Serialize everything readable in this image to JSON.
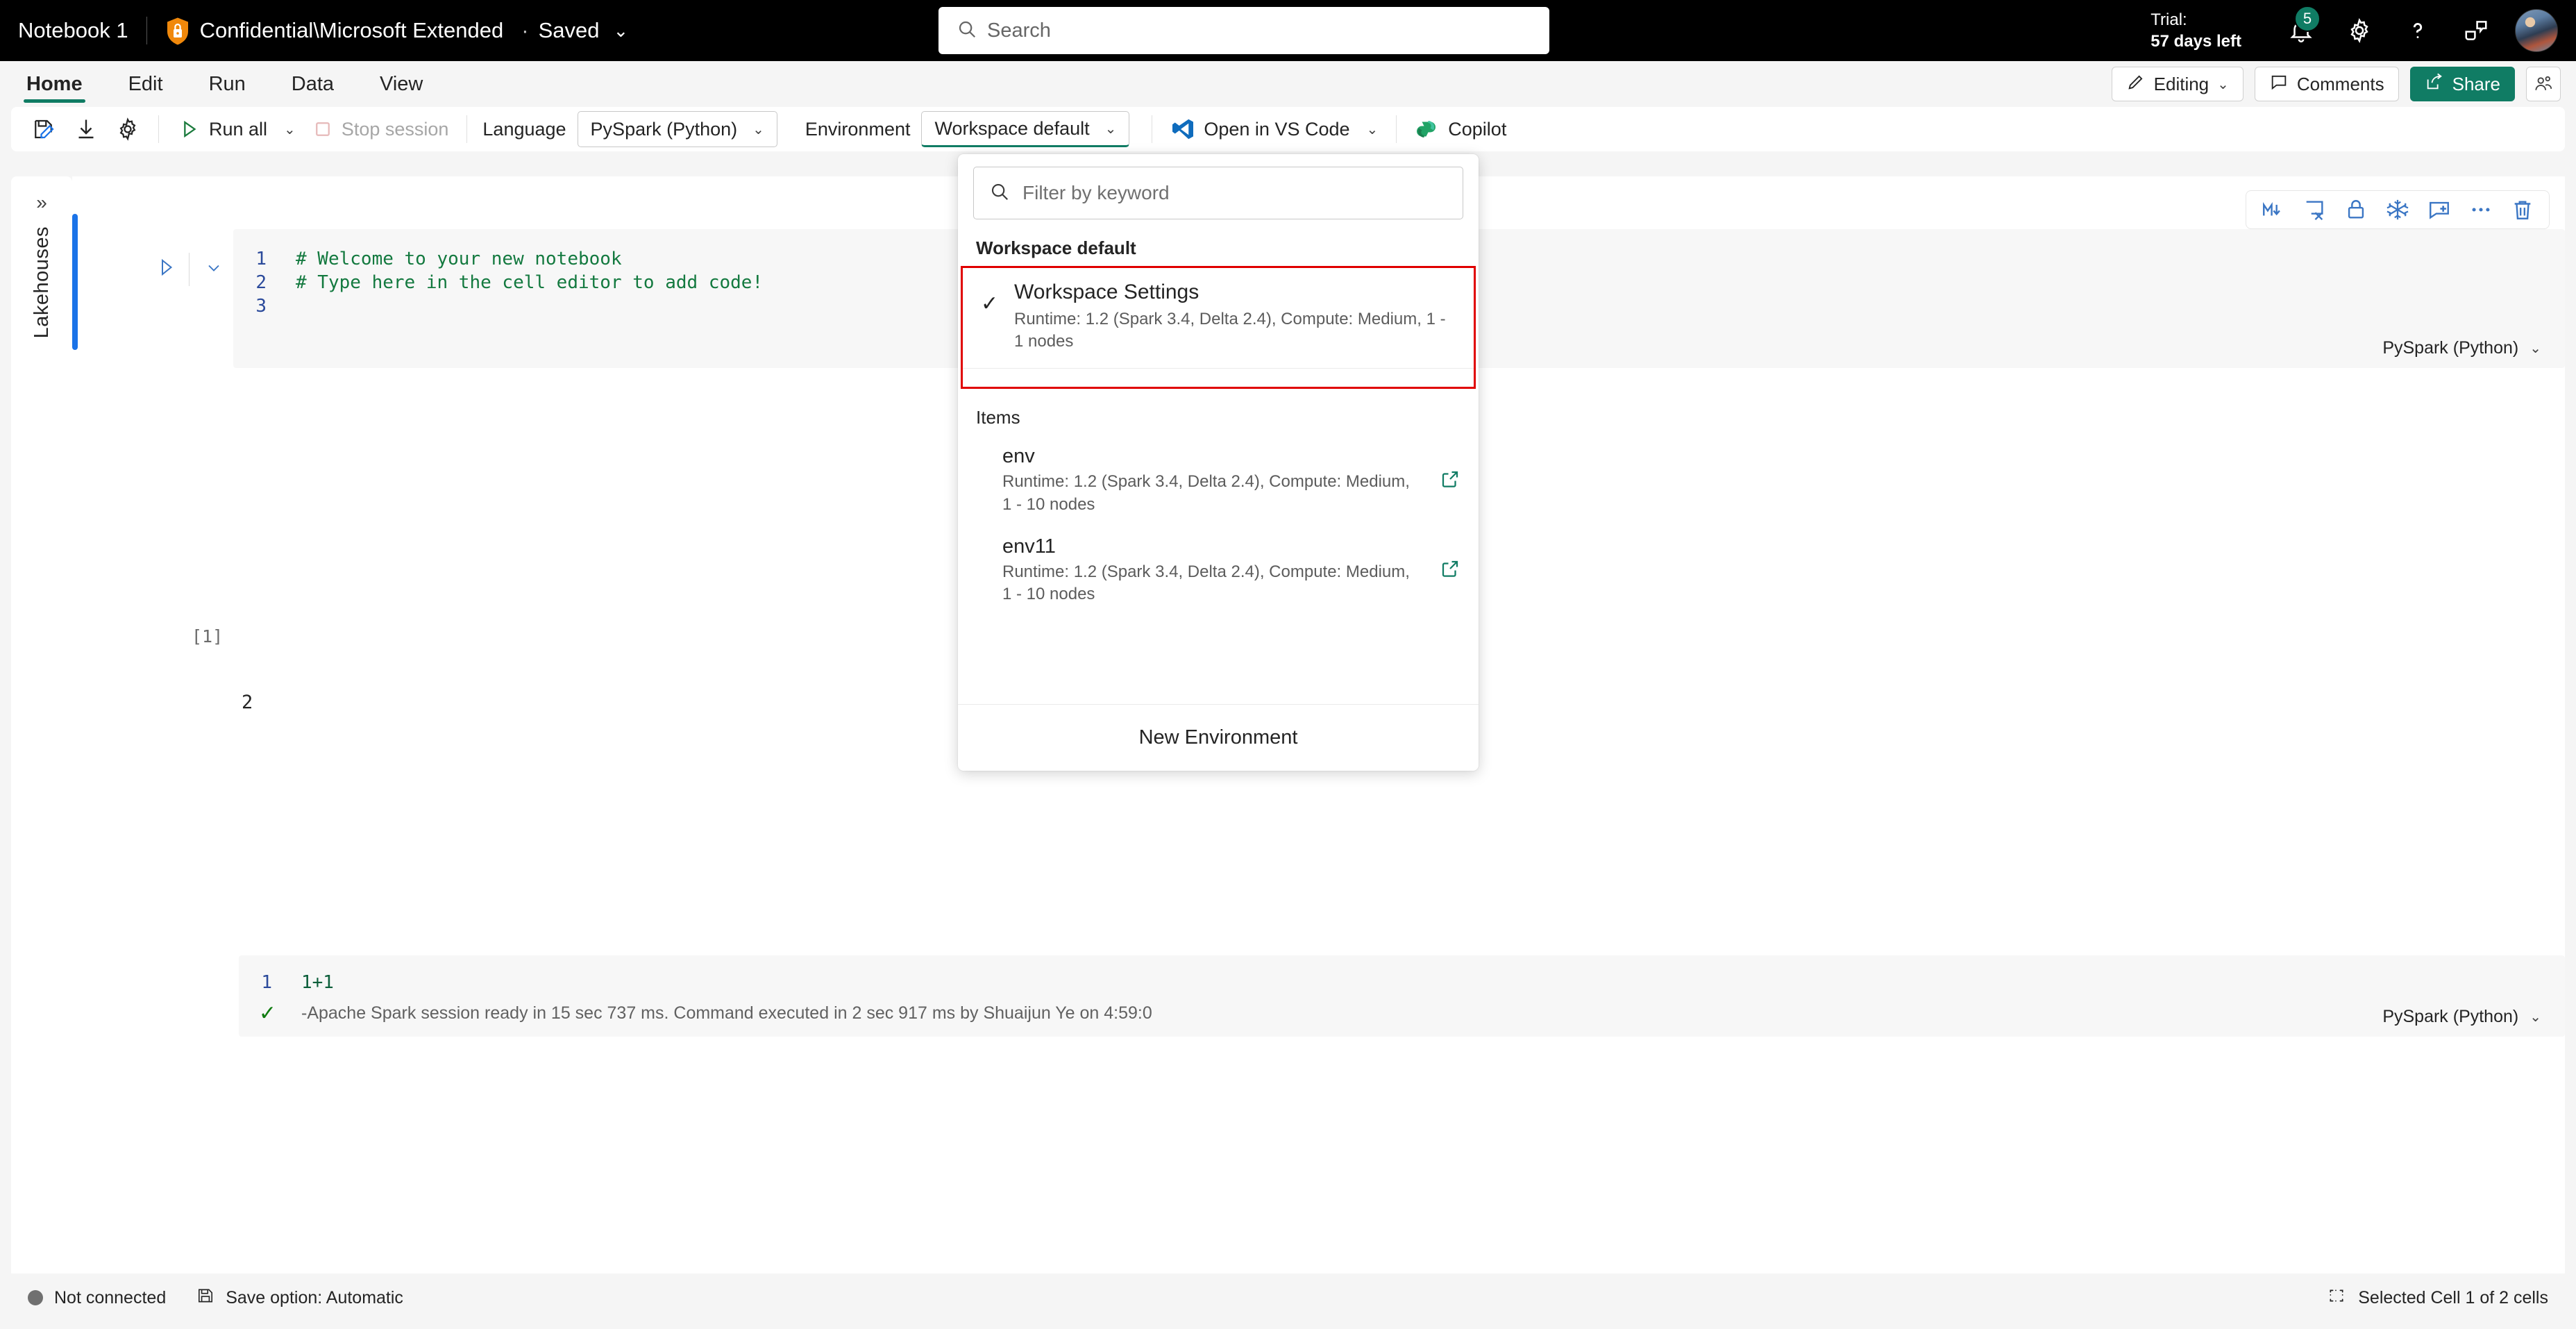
{
  "topbar": {
    "notebook_name": "Notebook 1",
    "sensitivity_label": "Confidential\\Microsoft Extended",
    "separator_dot": "·",
    "save_state": "Saved",
    "chevron": "⌄",
    "search_placeholder": "Search",
    "trial_line1": "Trial:",
    "trial_line2": "57 days left",
    "notification_count": "5"
  },
  "ribbon": {
    "tabs": [
      {
        "label": "Home",
        "active": true
      },
      {
        "label": "Edit",
        "active": false
      },
      {
        "label": "Run",
        "active": false
      },
      {
        "label": "Data",
        "active": false
      },
      {
        "label": "View",
        "active": false
      }
    ],
    "editing_label": "Editing",
    "editing_chevron": "⌄",
    "comments_label": "Comments",
    "share_label": "Share"
  },
  "toolbar": {
    "run_all_label": "Run all",
    "run_all_chevron": "⌄",
    "stop_session_label": "Stop session",
    "language_label": "Language",
    "language_value": "PySpark (Python)",
    "language_chevron": "⌄",
    "environment_label": "Environment",
    "environment_value": "Workspace default",
    "environment_chevron": "⌄",
    "vscode_label": "Open in VS Code",
    "vscode_chevron": "⌄",
    "copilot_label": "Copilot"
  },
  "left_rail": {
    "expand_chevron": "»",
    "label": "Lakehouses"
  },
  "cell_toolbar": {
    "markdown_label": "M↓",
    "clear_label": "clear-output",
    "lock_label": "lock",
    "freeze_label": "freeze",
    "comment_label": "add-comment",
    "more_label": "···",
    "delete_label": "delete"
  },
  "notebook": {
    "cells": [
      {
        "lines": [
          {
            "n": "1",
            "text": "# Welcome to your new notebook"
          },
          {
            "n": "2",
            "text": "# Type here in the cell editor to add code!"
          },
          {
            "n": "3",
            "text": ""
          }
        ],
        "language": "PySpark (Python)",
        "language_chevron": "⌄"
      },
      {
        "exec_count": "[1]",
        "lines": [
          {
            "n": "1",
            "text": "1+1"
          }
        ],
        "status_check": "✓",
        "status_text": "-Apache Spark session ready in 15 sec 737 ms. Command executed in 2 sec 917 ms by Shuaijun Ye on 4:59:0",
        "output": "2",
        "language": "PySpark (Python)",
        "language_chevron": "⌄"
      }
    ]
  },
  "environment_flyout": {
    "filter_placeholder": "Filter by keyword",
    "group_workspace_default": "Workspace default",
    "selected_option": {
      "tick": "✓",
      "name": "Workspace Settings",
      "description": "Runtime: 1.2 (Spark 3.4, Delta 2.4), Compute: Medium, 1 - 1 nodes"
    },
    "group_items": "Items",
    "items": [
      {
        "name": "env",
        "description": "Runtime: 1.2 (Spark 3.4, Delta 2.4), Compute: Medium, 1 - 10 nodes"
      },
      {
        "name": "env11",
        "description": "Runtime: 1.2 (Spark 3.4, Delta 2.4), Compute: Medium, 1 - 10 nodes"
      }
    ],
    "new_environment_label": "New Environment",
    "highlight_color": "#e00000"
  },
  "statusbar": {
    "connection": "Not connected",
    "save_option": "Save option: Automatic",
    "selection": "Selected Cell 1 of 2 cells"
  },
  "colors": {
    "brand_green": "#107c64",
    "accent_blue": "#1a73e8",
    "code_green": "#13793f"
  }
}
